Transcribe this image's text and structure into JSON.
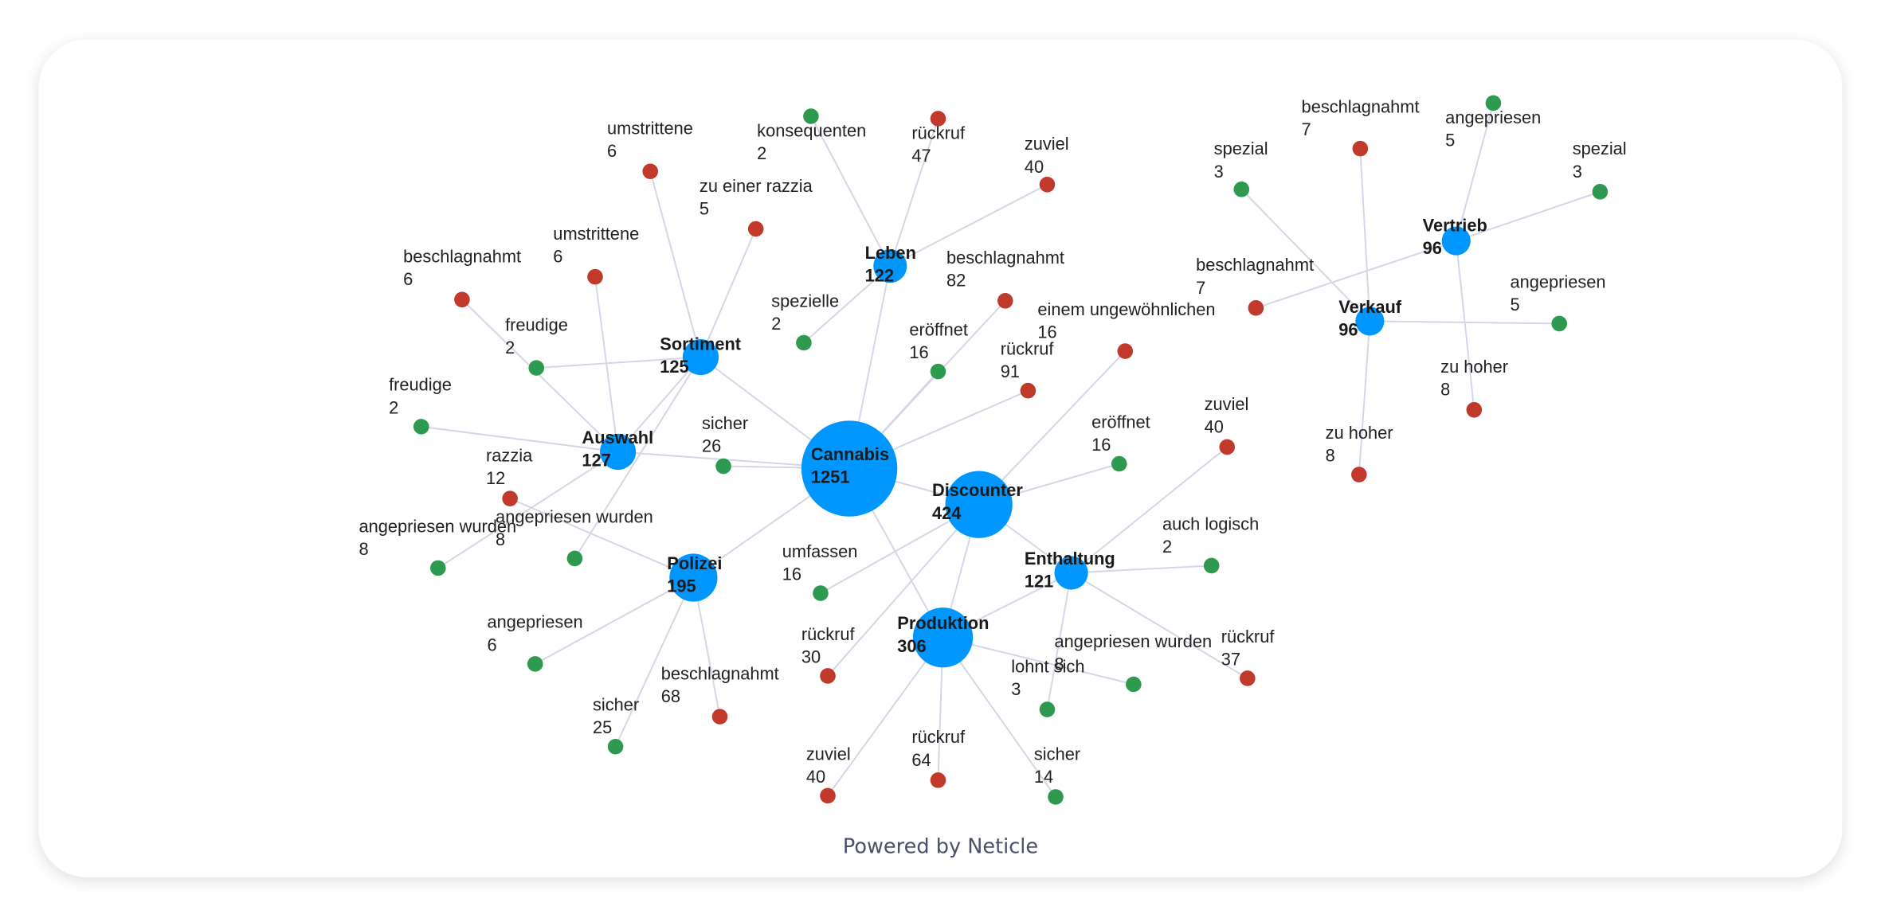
{
  "footer": "Powered by Neticle",
  "colors": {
    "hub": "#0096ff",
    "negative": "#c0392b",
    "positive": "#2e9a4f",
    "edge": "#d3d6e6"
  },
  "chart_data": {
    "type": "network",
    "nodes": [
      {
        "id": "cannabis",
        "label": "Cannabis",
        "value": 1251,
        "type": "hub"
      },
      {
        "id": "discounter",
        "label": "Discounter",
        "value": 424,
        "type": "hub"
      },
      {
        "id": "produktion",
        "label": "Produktion",
        "value": 306,
        "type": "hub"
      },
      {
        "id": "polizei",
        "label": "Polizei",
        "value": 195,
        "type": "hub"
      },
      {
        "id": "auswahl",
        "label": "Auswahl",
        "value": 127,
        "type": "hub"
      },
      {
        "id": "sortiment",
        "label": "Sortiment",
        "value": 125,
        "type": "hub"
      },
      {
        "id": "leben",
        "label": "Leben",
        "value": 122,
        "type": "hub"
      },
      {
        "id": "enthaltung",
        "label": "Enthaltung",
        "value": 121,
        "type": "hub"
      },
      {
        "id": "vertrieb",
        "label": "Vertrieb",
        "value": 96,
        "type": "hub"
      },
      {
        "id": "verkauf",
        "label": "Verkauf",
        "value": 96,
        "type": "hub"
      },
      {
        "id": "n1",
        "label": "umstrittene",
        "value": 6,
        "type": "negative"
      },
      {
        "id": "n2",
        "label": "zu einer razzia",
        "value": 5,
        "type": "negative"
      },
      {
        "id": "n3",
        "label": "freudige",
        "value": 2,
        "type": "positive"
      },
      {
        "id": "n4",
        "label": "angepriesen wurden",
        "value": 8,
        "type": "positive"
      },
      {
        "id": "n5",
        "label": "beschlagnahmt",
        "value": 6,
        "type": "negative"
      },
      {
        "id": "n6",
        "label": "umstrittene",
        "value": 6,
        "type": "negative"
      },
      {
        "id": "n7",
        "label": "freudige",
        "value": 2,
        "type": "positive"
      },
      {
        "id": "n8",
        "label": "angepriesen wurden",
        "value": 8,
        "type": "positive"
      },
      {
        "id": "n9",
        "label": "sicher",
        "value": 26,
        "type": "positive"
      },
      {
        "id": "n10",
        "label": "razzia",
        "value": 12,
        "type": "negative"
      },
      {
        "id": "n11",
        "label": "angepriesen",
        "value": 6,
        "type": "positive"
      },
      {
        "id": "n12",
        "label": "sicher",
        "value": 25,
        "type": "positive"
      },
      {
        "id": "n13",
        "label": "beschlagnahmt",
        "value": 68,
        "type": "negative"
      },
      {
        "id": "n14",
        "label": "konsequenten",
        "value": 2,
        "type": "positive"
      },
      {
        "id": "n15",
        "label": "rückruf",
        "value": 47,
        "type": "negative"
      },
      {
        "id": "n16",
        "label": "zuviel",
        "value": 40,
        "type": "negative"
      },
      {
        "id": "n17",
        "label": "spezielle",
        "value": 2,
        "type": "positive"
      },
      {
        "id": "n18",
        "label": "beschlagnahmt",
        "value": 82,
        "type": "negative"
      },
      {
        "id": "n19",
        "label": "eröffnet",
        "value": 16,
        "type": "positive"
      },
      {
        "id": "n20",
        "label": "rückruf",
        "value": 91,
        "type": "negative"
      },
      {
        "id": "n21",
        "label": "einem ungewöhnlichen",
        "value": 16,
        "type": "negative"
      },
      {
        "id": "n22",
        "label": "eröffnet",
        "value": 16,
        "type": "positive"
      },
      {
        "id": "n23",
        "label": "umfassen",
        "value": 16,
        "type": "positive"
      },
      {
        "id": "n24",
        "label": "rückruf",
        "value": 30,
        "type": "negative"
      },
      {
        "id": "n25",
        "label": "zuviel",
        "value": 40,
        "type": "negative"
      },
      {
        "id": "n26",
        "label": "auch logisch",
        "value": 2,
        "type": "positive"
      },
      {
        "id": "n27",
        "label": "rückruf",
        "value": 37,
        "type": "negative"
      },
      {
        "id": "n28",
        "label": "lohnt sich",
        "value": 3,
        "type": "positive"
      },
      {
        "id": "n29",
        "label": "angepriesen wurden",
        "value": 8,
        "type": "positive"
      },
      {
        "id": "n30",
        "label": "zuviel",
        "value": 40,
        "type": "negative"
      },
      {
        "id": "n31",
        "label": "rückruf",
        "value": 64,
        "type": "negative"
      },
      {
        "id": "n32",
        "label": "sicher",
        "value": 14,
        "type": "positive"
      },
      {
        "id": "n33",
        "label": "spezial",
        "value": 3,
        "type": "positive"
      },
      {
        "id": "n34",
        "label": "beschlagnahmt",
        "value": 7,
        "type": "negative"
      },
      {
        "id": "n35",
        "label": "angepriesen",
        "value": 5,
        "type": "positive"
      },
      {
        "id": "n36",
        "label": "spezial",
        "value": 3,
        "type": "positive"
      },
      {
        "id": "n37",
        "label": "beschlagnahmt",
        "value": 7,
        "type": "negative"
      },
      {
        "id": "n38",
        "label": "angepriesen",
        "value": 5,
        "type": "positive"
      },
      {
        "id": "n39",
        "label": "zu hoher",
        "value": 8,
        "type": "negative"
      },
      {
        "id": "n40",
        "label": "zu hoher",
        "value": 8,
        "type": "negative"
      }
    ],
    "edges": [
      [
        "cannabis",
        "sortiment"
      ],
      [
        "cannabis",
        "leben"
      ],
      [
        "cannabis",
        "auswahl"
      ],
      [
        "cannabis",
        "polizei"
      ],
      [
        "cannabis",
        "discounter"
      ],
      [
        "cannabis",
        "produktion"
      ],
      [
        "discounter",
        "produktion"
      ],
      [
        "discounter",
        "enthaltung"
      ],
      [
        "produktion",
        "enthaltung"
      ],
      [
        "sortiment",
        "auswahl"
      ],
      [
        "sortiment",
        "n1"
      ],
      [
        "sortiment",
        "n2"
      ],
      [
        "sortiment",
        "n3"
      ],
      [
        "sortiment",
        "n4"
      ],
      [
        "auswahl",
        "n5"
      ],
      [
        "auswahl",
        "n6"
      ],
      [
        "auswahl",
        "n7"
      ],
      [
        "auswahl",
        "n8"
      ],
      [
        "cannabis",
        "n9"
      ],
      [
        "polizei",
        "n10"
      ],
      [
        "polizei",
        "n11"
      ],
      [
        "polizei",
        "n12"
      ],
      [
        "polizei",
        "n13"
      ],
      [
        "leben",
        "n14"
      ],
      [
        "leben",
        "n15"
      ],
      [
        "leben",
        "n16"
      ],
      [
        "leben",
        "n17"
      ],
      [
        "cannabis",
        "n18"
      ],
      [
        "cannabis",
        "n19"
      ],
      [
        "cannabis",
        "n20"
      ],
      [
        "discounter",
        "n21"
      ],
      [
        "discounter",
        "n22"
      ],
      [
        "discounter",
        "n23"
      ],
      [
        "discounter",
        "n24"
      ],
      [
        "enthaltung",
        "n25"
      ],
      [
        "enthaltung",
        "n26"
      ],
      [
        "enthaltung",
        "n27"
      ],
      [
        "enthaltung",
        "n28"
      ],
      [
        "produktion",
        "n29"
      ],
      [
        "produktion",
        "n30"
      ],
      [
        "produktion",
        "n31"
      ],
      [
        "produktion",
        "n32"
      ],
      [
        "verkauf",
        "n33"
      ],
      [
        "verkauf",
        "n34"
      ],
      [
        "verkauf",
        "n38"
      ],
      [
        "verkauf",
        "n40"
      ],
      [
        "vertrieb",
        "n35"
      ],
      [
        "vertrieb",
        "n36"
      ],
      [
        "vertrieb",
        "n37"
      ],
      [
        "vertrieb",
        "n39"
      ]
    ]
  }
}
